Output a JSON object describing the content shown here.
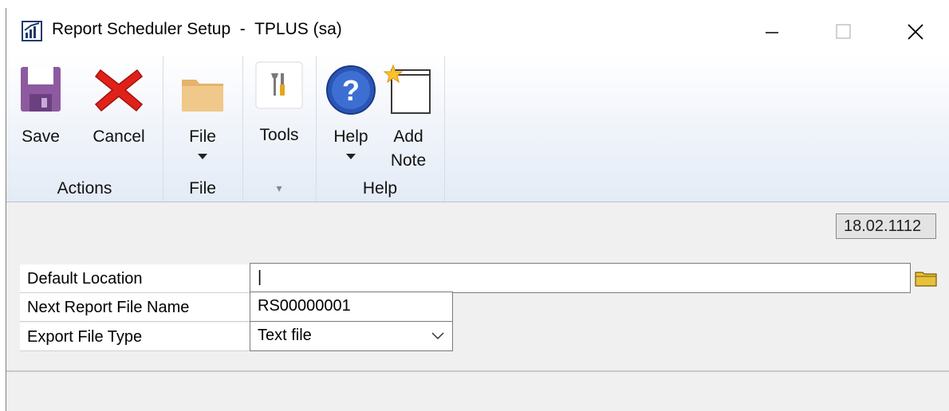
{
  "window": {
    "title": "Report Scheduler Setup  -  TPLUS (sa)",
    "controls": {
      "minimize": "—",
      "close": "✕"
    }
  },
  "ribbon": {
    "actions_group": {
      "label": "Actions",
      "save": "Save",
      "cancel": "Cancel"
    },
    "file_group": {
      "label": "File",
      "file": "File"
    },
    "tools_group": {
      "tools": "Tools",
      "collapse": "▾"
    },
    "help_group": {
      "label": "Help",
      "help": "Help",
      "add_note_line1": "Add",
      "add_note_line2": "Note"
    }
  },
  "version": "18.02.1112",
  "form": {
    "default_location": {
      "label": "Default Location",
      "value": "|"
    },
    "next_report_file_name": {
      "label": "Next Report File Name",
      "value": "RS00000001"
    },
    "export_file_type": {
      "label": "Export File Type",
      "value": "Text file"
    }
  },
  "icons": [
    "app-icon",
    "save-icon",
    "cancel-icon",
    "folder-icon",
    "tools-icon",
    "help-icon",
    "add-note-icon",
    "browse-folder-icon",
    "chevron-down-icon"
  ]
}
